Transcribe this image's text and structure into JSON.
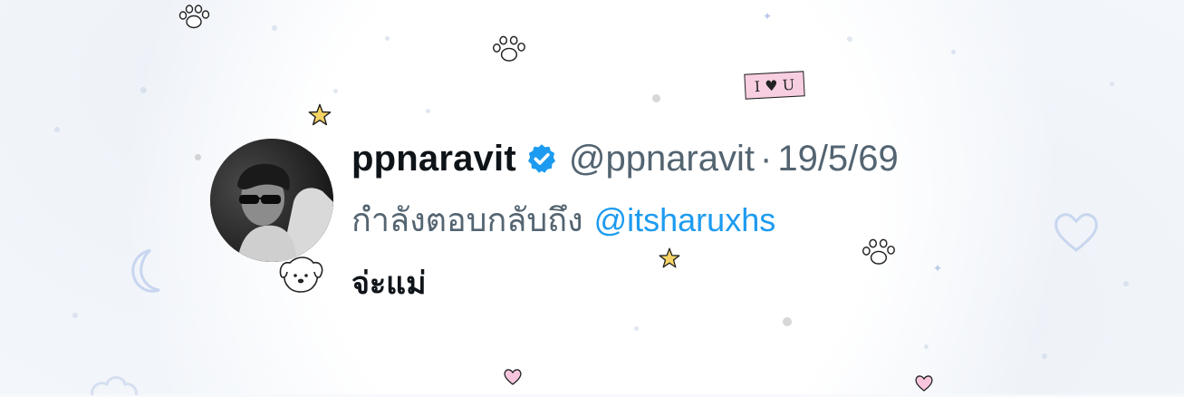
{
  "tweet": {
    "display_name": "ppnaravit",
    "handle": "@ppnaravit",
    "separator": "·",
    "date": "19/5/69",
    "reply_prefix": "กำลังตอบกลับถึง",
    "reply_mention": "@itsharuxhs",
    "text": "จ่ะแม่",
    "verified_color": "#1d9bf0"
  },
  "stickers": {
    "love_tag_text": "I ♥ U",
    "icons": [
      "paw-print-icon",
      "star-icon",
      "heart-icon",
      "dog-face-icon",
      "moon-icon",
      "heart-outline-icon"
    ]
  }
}
